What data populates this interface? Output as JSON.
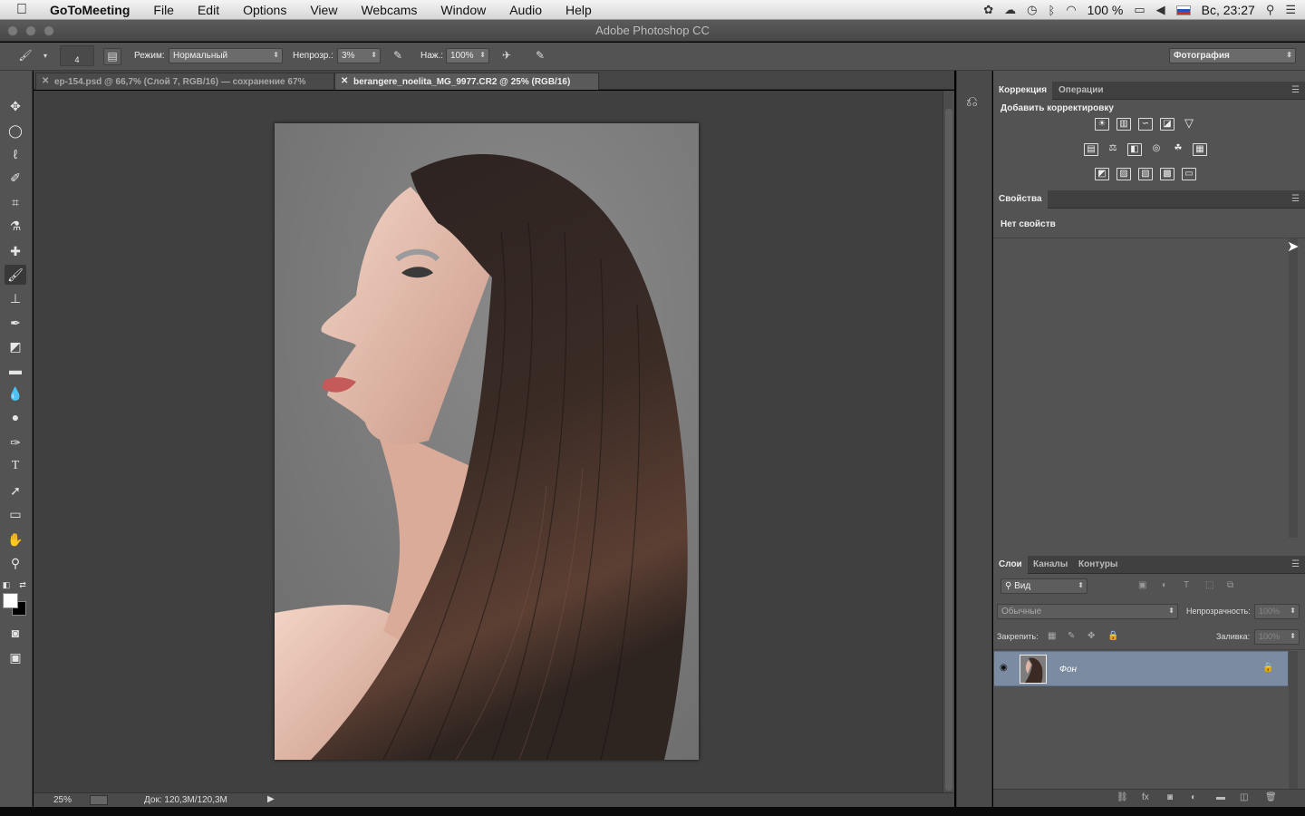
{
  "menubar": {
    "app": "GoToMeeting",
    "items": [
      "File",
      "Edit",
      "Options",
      "View",
      "Webcams",
      "Window",
      "Audio",
      "Help"
    ],
    "battery": "100 %",
    "time": "Вс, 23:27"
  },
  "window": {
    "title": "Adobe Photoshop CC"
  },
  "options": {
    "brush_size": "4",
    "mode_label": "Режим:",
    "mode_value": "Нормальный",
    "opacity_label": "Непрозр.:",
    "opacity_value": "3%",
    "flow_label": "Наж.:",
    "flow_value": "100%",
    "workspace": "Фотография"
  },
  "tabs": [
    {
      "label": "ep-154.psd @ 66,7% (Слой 7, RGB/16) — сохранение 67%"
    },
    {
      "label": "berangere_noelita_MG_9977.CR2 @ 25% (RGB/16)"
    }
  ],
  "statusbar": {
    "zoom": "25%",
    "doc": "Док: 120,3М/120,3М"
  },
  "panels": {
    "adjust": {
      "tabs": [
        "Коррекция",
        "Операции"
      ],
      "heading": "Добавить корректировку"
    },
    "props": {
      "tab": "Свойства",
      "message": "Нет свойств"
    },
    "layers": {
      "tabs": [
        "Слои",
        "Каналы",
        "Контуры"
      ],
      "filter": "Вид",
      "blend": "Обычные",
      "opacity_label": "Непрозрачность:",
      "opacity_value": "100%",
      "lock_label": "Закрепить:",
      "fill_label": "Заливка:",
      "fill_value": "100%",
      "layer_name": "Фон"
    }
  }
}
